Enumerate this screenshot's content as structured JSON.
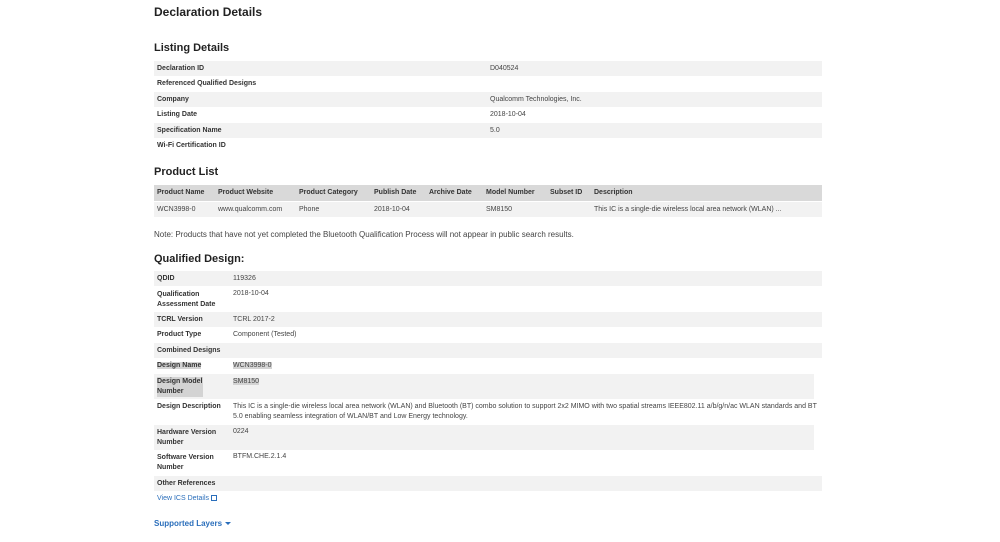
{
  "page_title": "Declaration Details",
  "listing": {
    "heading": "Listing Details",
    "rows": [
      {
        "label": "Declaration ID",
        "value": "D040524"
      },
      {
        "label": "Referenced Qualified Designs",
        "value": ""
      },
      {
        "label": "Company",
        "value": "Qualcomm Technologies, Inc."
      },
      {
        "label": "Listing Date",
        "value": "2018-10-04"
      },
      {
        "label": "Specification Name",
        "value": "5.0"
      },
      {
        "label": "Wi-Fi Certification ID",
        "value": ""
      }
    ]
  },
  "product_list": {
    "heading": "Product List",
    "columns": [
      "Product Name",
      "Product Website",
      "Product Category",
      "Publish Date",
      "Archive Date",
      "Model Number",
      "Subset ID",
      "Description"
    ],
    "row": [
      "WCN3998-0",
      "www.qualcomm.com",
      "Phone",
      "2018-10-04",
      "",
      "SM8150",
      "",
      "This IC is a single-die wireless local area network (WLAN) ..."
    ]
  },
  "note": "Note: Products that have not yet completed the Bluetooth Qualification Process will not appear in public search results.",
  "qualified": {
    "heading": "Qualified Design:",
    "qdid_label": "QDID",
    "qdid": "119326",
    "qad_label_1": "Qualification",
    "qad_label_2": "Assessment Date",
    "qad": "2018-10-04",
    "tcrl_label": "TCRL Version",
    "tcrl": "TCRL 2017-2",
    "type_label": "Product Type",
    "type": "Component (Tested)",
    "combined_label": "Combined Designs",
    "dname_label": "Design Name",
    "dname": "WCN3998-0",
    "dmodel_label_1": "Design Model",
    "dmodel_label_2": "Number",
    "dmodel": "SM8150",
    "desc_label": "Design Description",
    "desc_1": "This IC is a single-die wireless local area network (WLAN) and Bluetooth (BT) combo solution to support 2x2 MIMO with two spatial streams IEEE802.11 a/b/g/n/ac WLAN standards and BT",
    "desc_2": "5.0 enabling seamless integration of WLAN/BT and Low Energy technology.",
    "hw_label_1": "Hardware Version",
    "hw_label_2": "Number",
    "hw": "0224",
    "sw_label_1": "Software Version",
    "sw_label_2": "Number",
    "sw": "BTFM.CHE.2.1.4",
    "other_label": "Other References",
    "ics_link": "View ICS Details"
  },
  "supported_layers": "Supported Layers",
  "colors": {
    "link": "#2a6ebb",
    "shade": "#f2f2f2",
    "header": "#d9d9d9"
  }
}
